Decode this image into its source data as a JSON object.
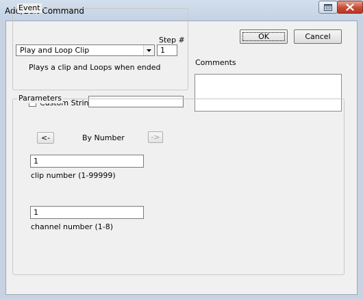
{
  "window": {
    "title": "Add/Edit Command",
    "restore_icon": "restore-icon",
    "close_icon": "close-icon"
  },
  "event": {
    "group_label": "Event",
    "step_label": "Step #",
    "step_value": "1",
    "command_selected": "Play and Loop Clip",
    "command_description": "Plays a clip and Loops when ended",
    "custom_string_label": "Custom String",
    "custom_string_checked": false,
    "custom_string_value": ""
  },
  "actions": {
    "ok_label": "OK",
    "cancel_label": "Cancel"
  },
  "comments": {
    "label": "Comments",
    "value": ""
  },
  "parameters": {
    "group_label": "Parameters",
    "prev_label": "<-",
    "mode_label": "By Number",
    "next_label": "->",
    "fields": [
      {
        "value": "1",
        "label": "clip number (1-99999)"
      },
      {
        "value": "1",
        "label": "channel number (1-8)"
      }
    ]
  }
}
